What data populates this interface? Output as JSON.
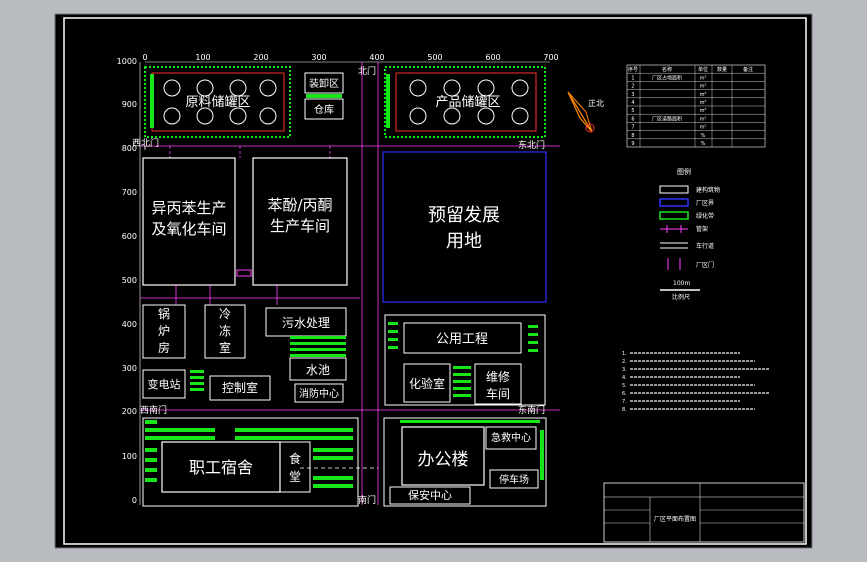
{
  "colors": {
    "background": "#000000",
    "frame": "#ffffff",
    "building": "#ffffff",
    "boundary": "#3030ff",
    "green": "#19e619",
    "road": "#ff40ff",
    "tank": "#ff3030",
    "compass": "#ff8800"
  },
  "axis": {
    "x_ticks": [
      "0",
      "100",
      "200",
      "300",
      "400",
      "500",
      "600",
      "700"
    ],
    "y_ticks": [
      "1000",
      "900",
      "800",
      "700",
      "600",
      "500",
      "400",
      "300",
      "200",
      "100",
      "0"
    ]
  },
  "buildings": {
    "raw_tank": "原料储罐区",
    "loading": "装卸区",
    "warehouse": "仓库",
    "product_tank": "产品储罐区",
    "cumene_1": "异丙苯生产",
    "cumene_2": "及氧化车间",
    "phenol_1": "苯酚/丙酮",
    "phenol_2": "生产车间",
    "reserve_1": "预留发展",
    "reserve_2": "用地",
    "boiler_1": "锅",
    "boiler_2": "炉",
    "boiler_3": "房",
    "freezer_1": "冷",
    "freezer_2": "冻",
    "freezer_3": "室",
    "sewage": "污水处理",
    "pool": "水池",
    "fire": "消防中心",
    "substation": "变电站",
    "control": "控制室",
    "utility": "公用工程",
    "lab": "化验室",
    "repair_1": "维修",
    "repair_2": "车间",
    "dorm": "职工宿舍",
    "canteen_1": "食",
    "canteen_2": "堂",
    "office": "办公楼",
    "rescue": "急救中心",
    "parking": "停车场",
    "security": "保安中心"
  },
  "gates": {
    "north": "北门",
    "northwest": "西北门",
    "northeast": "东北门",
    "southwest": "西南门",
    "southeast": "东南门",
    "south": "南门"
  },
  "compass": {
    "label": "正北"
  },
  "table": {
    "headers": [
      "序号",
      "名称",
      "单位",
      "数量",
      "备注"
    ],
    "rows": [
      [
        "1",
        "厂区占地面积",
        "m²",
        "",
        ""
      ],
      [
        "2",
        "",
        "m²",
        "",
        ""
      ],
      [
        "3",
        "",
        "m²",
        "",
        ""
      ],
      [
        "4",
        "",
        "m²",
        "",
        ""
      ],
      [
        "5",
        "",
        "m²",
        "",
        ""
      ],
      [
        "6",
        "厂区道路面积",
        "m²",
        "",
        ""
      ],
      [
        "7",
        "",
        "m²",
        "",
        ""
      ],
      [
        "8",
        "",
        "%",
        "",
        ""
      ],
      [
        "9",
        "",
        "%",
        "",
        ""
      ]
    ]
  },
  "legend": {
    "title": "图例",
    "items": [
      "建构筑物",
      "厂区界",
      "绿化带",
      "管架",
      "车行道",
      "厂区门"
    ]
  },
  "scale": {
    "value": "100m",
    "label": "比例尺"
  },
  "notes": [
    "1.",
    "2.",
    "3.",
    "4.",
    "5.",
    "6.",
    "7.",
    "8."
  ],
  "titleblock": {
    "drawing_name": "厂区平面布置图"
  }
}
